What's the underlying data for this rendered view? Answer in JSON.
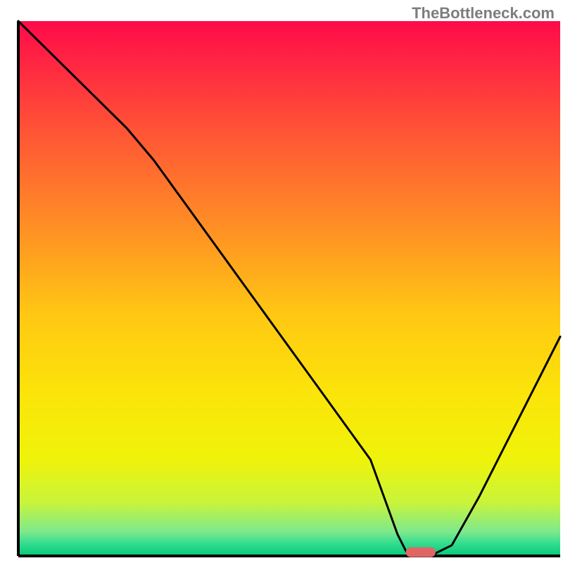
{
  "watermark": "TheBottleneck.com",
  "chart_data": {
    "type": "line",
    "title": "",
    "xlabel": "",
    "ylabel": "",
    "xlim": [
      0,
      100
    ],
    "ylim": [
      0,
      100
    ],
    "x": [
      0,
      5,
      10,
      15,
      20,
      25,
      30,
      35,
      40,
      45,
      50,
      55,
      60,
      65,
      70,
      72,
      76,
      80,
      85,
      90,
      95,
      100
    ],
    "y": [
      100,
      95,
      90,
      85,
      80,
      74,
      67,
      60,
      53,
      46,
      39,
      32,
      25,
      18,
      4,
      0,
      0,
      2,
      11,
      21,
      31,
      41
    ],
    "marker_x_range": [
      71.5,
      77
    ],
    "marker_y": 0.7,
    "gradient_stops": [
      {
        "offset": 0.0,
        "color": "#ff0a4a"
      },
      {
        "offset": 0.2,
        "color": "#ff5236"
      },
      {
        "offset": 0.4,
        "color": "#ff9423"
      },
      {
        "offset": 0.55,
        "color": "#ffc813"
      },
      {
        "offset": 0.7,
        "color": "#fbe50a"
      },
      {
        "offset": 0.82,
        "color": "#eff30a"
      },
      {
        "offset": 0.9,
        "color": "#c9f43b"
      },
      {
        "offset": 0.955,
        "color": "#7de98d"
      },
      {
        "offset": 0.978,
        "color": "#2fdc8f"
      },
      {
        "offset": 1.0,
        "color": "#06c87a"
      }
    ],
    "axis_color": "#000000",
    "marker_color": "#e06666"
  }
}
